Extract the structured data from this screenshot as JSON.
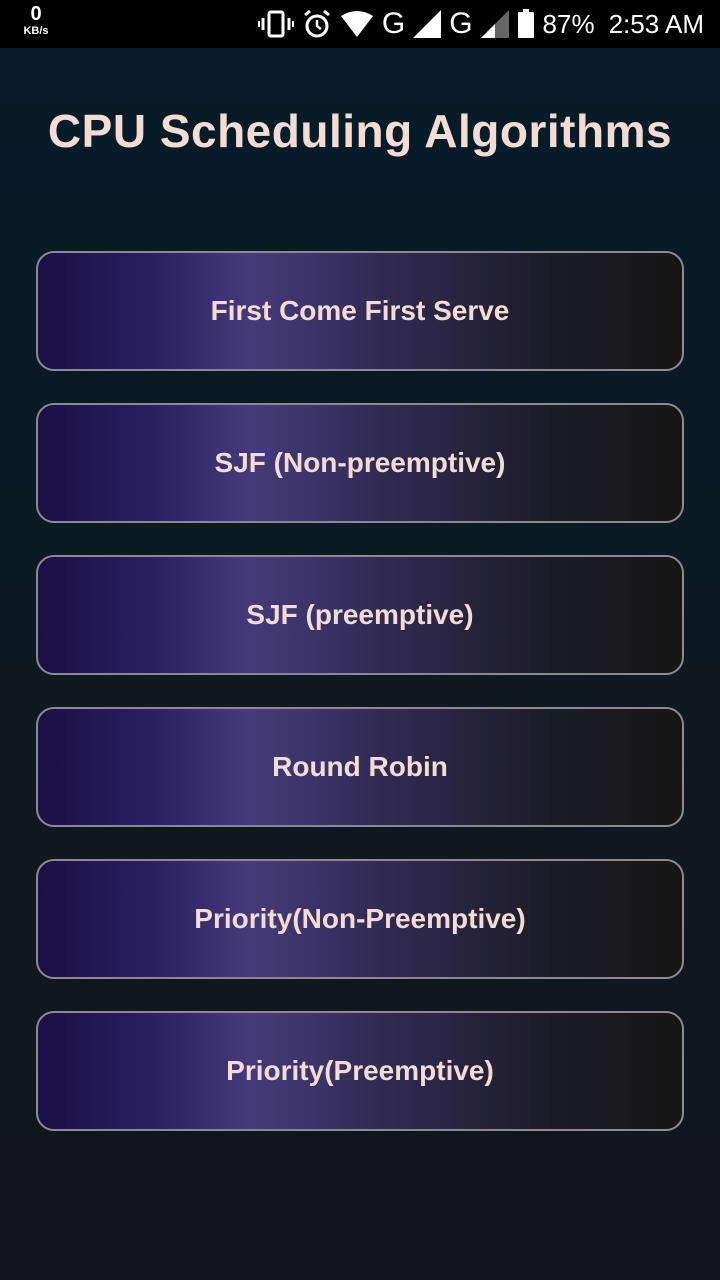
{
  "status_bar": {
    "net_speed_value": "0",
    "net_speed_unit": "KB/s",
    "network_1": "G",
    "network_2": "G",
    "battery": "87%",
    "time": "2:53 AM",
    "icons": [
      "vibrate-icon",
      "alarm-icon",
      "wifi-icon",
      "signal-icon",
      "signal-icon",
      "battery-icon"
    ]
  },
  "header": {
    "title": "CPU Scheduling Algorithms"
  },
  "menu": {
    "buttons": [
      {
        "label": "First Come First Serve"
      },
      {
        "label": "SJF (Non-preemptive)"
      },
      {
        "label": "SJF (preemptive)"
      },
      {
        "label": "Round Robin"
      },
      {
        "label": "Priority(Non-Preemptive)"
      },
      {
        "label": "Priority(Preemptive)"
      }
    ]
  },
  "colors": {
    "title_text": "#f3dcd4",
    "button_border": "#8a8a92",
    "button_gradient_left": "#1a0f47",
    "button_gradient_mid": "#453a7a",
    "button_gradient_right": "#161616"
  }
}
